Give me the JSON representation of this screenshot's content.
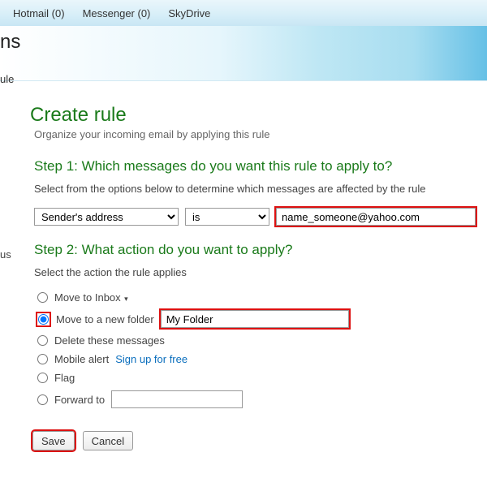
{
  "topnav": {
    "hotmail": "Hotmail (0)",
    "messenger": "Messenger (0)",
    "skydrive": "SkyDrive"
  },
  "header": {
    "title_fragment": "ns",
    "subnav_fragment": "ule"
  },
  "sidebar_fragment": "us",
  "page": {
    "title": "Create rule",
    "hint": "Organize your incoming email by applying this rule"
  },
  "step1": {
    "heading": "Step 1: Which messages do you want this rule to apply to?",
    "instruction": "Select from the options below to determine which messages are affected by the rule",
    "field_selected": "Sender's address",
    "operator_selected": "is",
    "address_value": "name_someone@yahoo.com"
  },
  "step2": {
    "heading": "Step 2: What action do you want to apply?",
    "instruction": "Select the action the rule applies",
    "actions": {
      "move_inbox": "Move to Inbox",
      "move_new_folder": "Move to a new folder",
      "folder_value": "My Folder",
      "delete": "Delete these messages",
      "mobile_alert": "Mobile alert",
      "mobile_alert_link": "Sign up for free",
      "flag": "Flag",
      "forward_to": "Forward to",
      "forward_value": ""
    }
  },
  "buttons": {
    "save": "Save",
    "cancel": "Cancel"
  }
}
